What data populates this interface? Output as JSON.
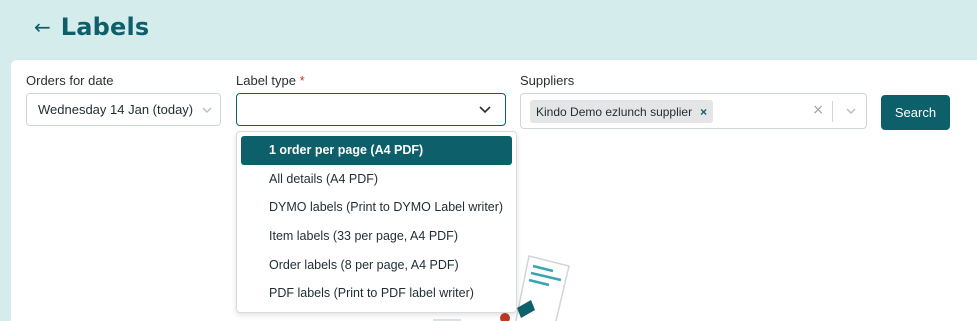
{
  "header": {
    "back_icon": "arrow-left-icon",
    "title": "Labels"
  },
  "filters": {
    "date": {
      "label": "Orders for date",
      "value": "Wednesday 14 Jan (today)"
    },
    "label_type": {
      "label": "Label type",
      "required_mark": "*",
      "value": ""
    },
    "suppliers": {
      "label": "Suppliers",
      "chips": [
        "Kindo Demo ezlunch supplier"
      ],
      "chip_remove": "×",
      "clear_icon": "×"
    },
    "search_label": "Search"
  },
  "dropdown": {
    "options": [
      "1 order per page (A4 PDF)",
      "All details (A4 PDF)",
      "DYMO labels (Print to DYMO Label writer)",
      "Item labels (33 per page, A4 PDF)",
      "Order labels (8 per page, A4 PDF)",
      "PDF labels (Print to PDF label writer)"
    ],
    "selected_index": 0
  },
  "colors": {
    "accent": "#0d5f6a",
    "background": "#d4ecec",
    "required": "#c0392b"
  }
}
